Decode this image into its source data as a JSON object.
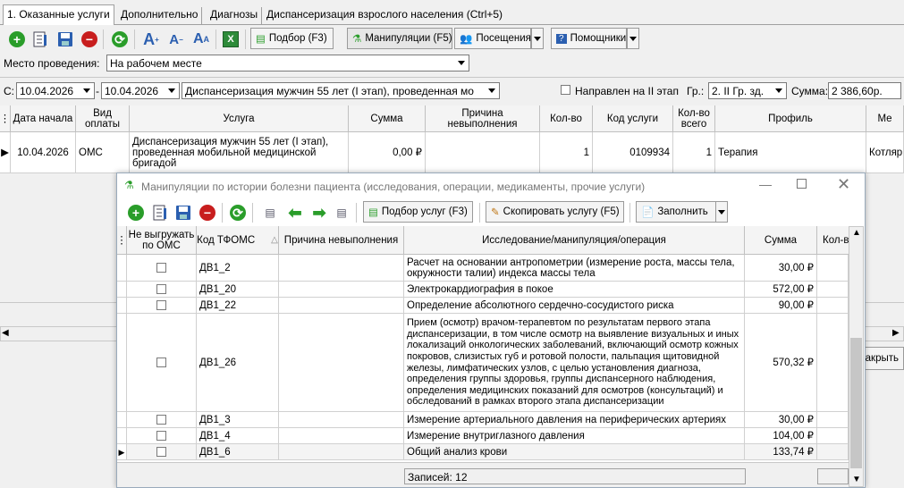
{
  "tabs": [
    "1. Оказанные услуги",
    "Дополнительно",
    "Диагнозы",
    "Диспансеризация взрослого населения (Ctrl+5)"
  ],
  "toolbar": {
    "podbor": "Подбор (F3)",
    "manip": "Манипуляции (F5)",
    "posesh": "Посещения",
    "pomosh": "Помощники"
  },
  "place": {
    "label": "Место проведения:",
    "value": "На рабочем месте"
  },
  "filter": {
    "from_label": "С:",
    "date_from": "10.04.2026",
    "dash": "-",
    "date_to": "10.04.2026",
    "type": "Диспансеризация мужчин 55 лет (I этап), проведенная мо",
    "napr": "Направлен на II этап",
    "gr_label": "Гр.:",
    "gr": "2. II Гр. зд.",
    "sum_label": "Сумма:",
    "sum": "2 386,60р."
  },
  "main_grid": {
    "headers": [
      "Дата начала",
      "Вид оплаты",
      "Услуга",
      "Сумма",
      "Причина невыполнения",
      "Кол-во",
      "Код услуги",
      "Кол-во всего",
      "Профиль",
      "Ме"
    ],
    "row": {
      "date": "10.04.2026",
      "pay": "ОМС",
      "service": "Диспансеризация мужчин 55 лет (I этап), проведенная мобильной медицинской бригадой",
      "sum": "0,00 ₽",
      "qty": "1",
      "code": "0109934",
      "total": "1",
      "profile": "Терапия",
      "me": "Котляр"
    }
  },
  "close_btn": "акрыть",
  "dialog": {
    "title": "Манипуляции по истории болезни пациента (исследования, операции, медикаменты, прочие услуги)",
    "podbor": "Подбор услуг (F3)",
    "copy": "Скопировать услугу (F5)",
    "fill": "Заполнить",
    "headers": [
      "Не выгружать по ОМС",
      "Код ТФОМС",
      "Причина невыполнения",
      "Исследование/манипуляция/операция",
      "Сумма",
      "Кол-в"
    ],
    "rows": [
      {
        "code": "ДВ1_2",
        "name": "Расчет на основании антропометрии (измерение роста, массы тела, окружности талии) индекса массы тела",
        "sum": "30,00 ₽"
      },
      {
        "code": "ДВ1_20",
        "name": "Электрокардиография в покое",
        "sum": "572,00 ₽"
      },
      {
        "code": "ДВ1_22",
        "name": "Определение абсолютного сердечно-сосудистого риска",
        "sum": "90,00 ₽"
      },
      {
        "code": "ДВ1_26",
        "name": "Прием (осмотр) врачом-терапевтом по результатам первого этапа диспансеризации, в том числе осмотр на выявление визуальных и иных локализаций онкологических заболеваний, включающий осмотр кожных покровов, слизистых губ и ротовой полости, пальпация щитовидной железы, лимфатических узлов, с целью установления диагноза, определения группы здоровья, группы диспансерного наблюдения, определения медицинских показаний для осмотров (консультаций) и обследований в рамках второго этапа диспансеризации",
        "sum": "570,32 ₽"
      },
      {
        "code": "ДВ1_3",
        "name": "Измерение артериального давления на периферических артериях",
        "sum": "30,00 ₽"
      },
      {
        "code": "ДВ1_4",
        "name": "Измерение внутриглазного давления",
        "sum": "104,00 ₽"
      },
      {
        "code": "ДВ1_6",
        "name": "Общий анализ крови",
        "sum": "133,74 ₽"
      }
    ],
    "records": "Записей: 12"
  }
}
